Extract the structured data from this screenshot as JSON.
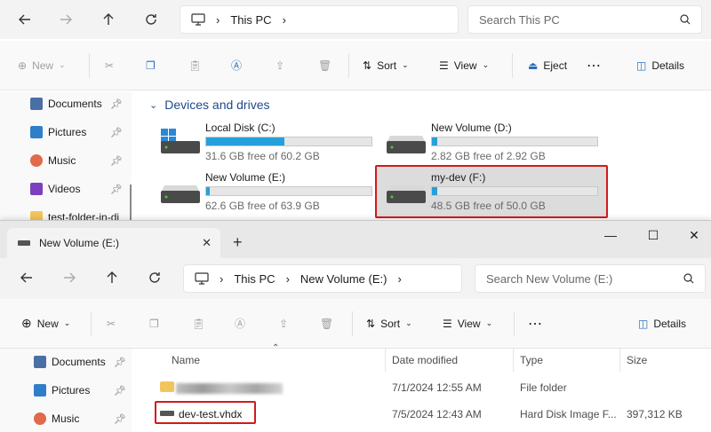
{
  "window_back": {
    "address": {
      "crumbs": [
        "This PC"
      ]
    },
    "search_placeholder": "Search This PC",
    "toolbar": {
      "new_label": "New",
      "sort_label": "Sort",
      "view_label": "View",
      "eject_label": "Eject",
      "details_label": "Details"
    },
    "sidebar": [
      {
        "label": "Documents",
        "icon": "documents-icon",
        "color": "#4a6fa5"
      },
      {
        "label": "Pictures",
        "icon": "pictures-icon",
        "color": "#2f7fc8"
      },
      {
        "label": "Music",
        "icon": "music-icon",
        "color": "#e06a4a"
      },
      {
        "label": "Videos",
        "icon": "videos-icon",
        "color": "#7b3fbf"
      },
      {
        "label": "test-folder-in-di",
        "icon": "folder-icon",
        "color": "#f2c55c"
      }
    ],
    "section_title": "Devices and drives",
    "drives": [
      {
        "name": "Local Disk (C:)",
        "free": "31.6 GB free of 60.2 GB",
        "used_fraction": 0.475
      },
      {
        "name": "New Volume (D:)",
        "free": "2.82 GB free of 2.92 GB",
        "used_fraction": 0.034
      },
      {
        "name": "New Volume (E:)",
        "free": "62.6 GB free of 63.9 GB",
        "used_fraction": 0.02
      },
      {
        "name": "my-dev (F:)",
        "free": "48.5 GB free of 50.0 GB",
        "used_fraction": 0.03
      }
    ]
  },
  "window_front": {
    "tab_title": "New Volume (E:)",
    "address": {
      "crumbs": [
        "This PC",
        "New Volume (E:)"
      ]
    },
    "search_placeholder": "Search New Volume (E:)",
    "toolbar": {
      "new_label": "New",
      "sort_label": "Sort",
      "view_label": "View",
      "details_label": "Details"
    },
    "sidebar": [
      {
        "label": "Documents",
        "icon": "documents-icon",
        "color": "#4a6fa5"
      },
      {
        "label": "Pictures",
        "icon": "pictures-icon",
        "color": "#2f7fc8"
      },
      {
        "label": "Music",
        "icon": "music-icon",
        "color": "#e06a4a"
      }
    ],
    "columns": {
      "name": "Name",
      "date": "Date modified",
      "type": "Type",
      "size": "Size"
    },
    "files": [
      {
        "name": "",
        "date": "7/1/2024 12:55 AM",
        "type": "File folder",
        "size": ""
      },
      {
        "name": "dev-test.vhdx",
        "date": "7/5/2024 12:43 AM",
        "type": "Hard Disk Image F...",
        "size": "397,312 KB"
      }
    ]
  },
  "colors": {
    "accent": "#26a0da",
    "highlight": "#d11a1a",
    "section_title": "#1e4a8a"
  }
}
